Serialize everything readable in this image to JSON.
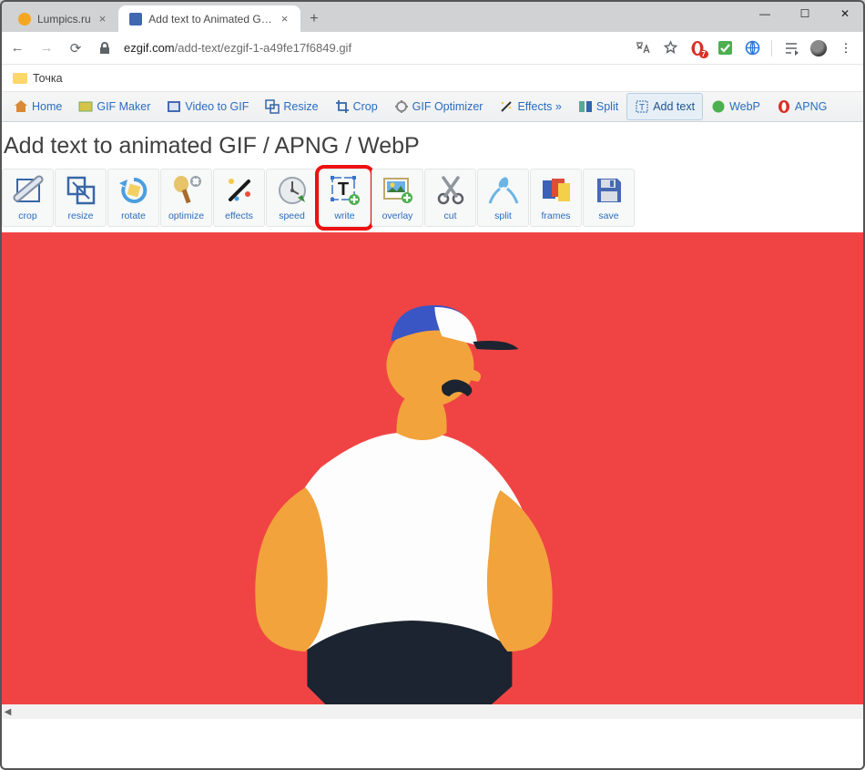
{
  "window": {
    "tabs": [
      {
        "label": "Lumpics.ru",
        "active": false,
        "favicon_color": "#f5a623"
      },
      {
        "label": "Add text to Animated GIFs - gif-...",
        "active": true,
        "favicon_color": "#4267b2"
      }
    ],
    "controls": {
      "minimize": "—",
      "maximize": "☐",
      "close": "✕"
    }
  },
  "address": {
    "lock_label": "secure",
    "host": "ezgif.com",
    "path": "/add-text/ezgif-1-a49fe17f6849.gif"
  },
  "bookmark_item": "Точка",
  "extensions": {
    "translate": "translate-icon",
    "star": "star-icon",
    "opera": "opera-icon",
    "check": "check-icon",
    "globe": "globe-icon",
    "readlist": "read-list-icon",
    "avatar": "avatar-icon",
    "menu": "menu-icon"
  },
  "sitebar": [
    {
      "label": "Home",
      "icon": "home"
    },
    {
      "label": "GIF Maker",
      "icon": "gif"
    },
    {
      "label": "Video to GIF",
      "icon": "video"
    },
    {
      "label": "Resize",
      "icon": "resize"
    },
    {
      "label": "Crop",
      "icon": "crop"
    },
    {
      "label": "GIF Optimizer",
      "icon": "optimize"
    },
    {
      "label": "Effects »",
      "icon": "effects"
    },
    {
      "label": "Split",
      "icon": "split"
    },
    {
      "label": "Add text",
      "icon": "text",
      "active": true
    },
    {
      "label": "WebP",
      "icon": "webp"
    },
    {
      "label": "APNG",
      "icon": "apng"
    }
  ],
  "page_title": "Add text to animated GIF / APNG / WebP",
  "tools": [
    {
      "label": "crop"
    },
    {
      "label": "resize"
    },
    {
      "label": "rotate"
    },
    {
      "label": "optimize"
    },
    {
      "label": "effects"
    },
    {
      "label": "speed"
    },
    {
      "label": "write",
      "highlighted": true
    },
    {
      "label": "overlay"
    },
    {
      "label": "cut"
    },
    {
      "label": "split"
    },
    {
      "label": "frames"
    },
    {
      "label": "save"
    }
  ]
}
